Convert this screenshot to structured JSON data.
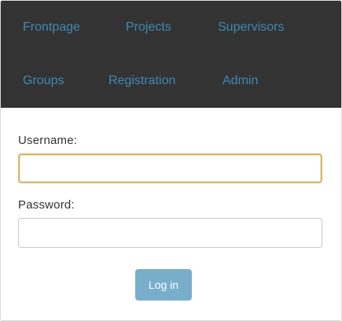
{
  "nav": {
    "items": [
      {
        "label": "Frontpage"
      },
      {
        "label": "Projects"
      },
      {
        "label": "Supervisors"
      },
      {
        "label": "Groups"
      },
      {
        "label": "Registration"
      },
      {
        "label": "Admin"
      }
    ]
  },
  "login_form": {
    "username_label": "Username:",
    "username_value": "",
    "password_label": "Password:",
    "password_value": "",
    "submit_label": "Log in"
  },
  "colors": {
    "navbar_bg": "#333333",
    "nav_link": "#3f88b4",
    "focus_border": "#d5b86a",
    "button_bg": "#79aecb"
  }
}
